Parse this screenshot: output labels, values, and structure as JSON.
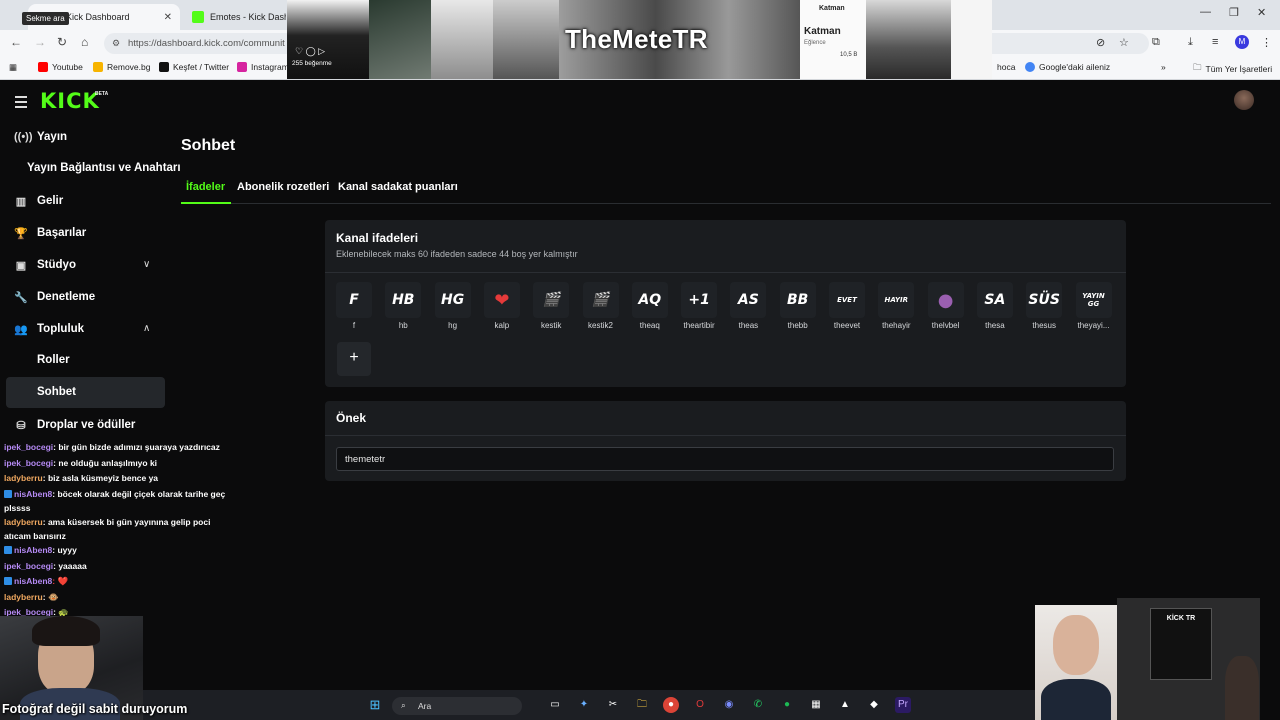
{
  "browser": {
    "tabs": [
      {
        "title": "Kick Dashboard",
        "active": true
      },
      {
        "title": "Emotes - Kick Dashboa",
        "active": false
      }
    ],
    "tooltip": "Sekme ara",
    "url": "https://dashboard.kick.com/communit",
    "profile_initial": "M",
    "bookmarks": [
      {
        "label": "Youtube",
        "color": "#ff0000"
      },
      {
        "label": "Remove.bg",
        "color": "#f7b400"
      },
      {
        "label": "Keşfet / Twitter",
        "color": "#111111"
      },
      {
        "label": "Instagram",
        "color": "#d6249f"
      },
      {
        "label": "hoca",
        "color": ""
      },
      {
        "label": "Google'daki aileniz",
        "color": "#4285f4"
      },
      {
        "label": "Tüm Yer İşaretleri",
        "color": ""
      }
    ]
  },
  "overlay": {
    "title": "TheMeteTR",
    "likes": "255 beğenme",
    "card_title": "Katman",
    "card_sub": "Eğlence",
    "card_count": "10,5 B"
  },
  "app": {
    "logo": "KICK",
    "beta": "BETA",
    "sidebar": [
      {
        "label": "Yayın",
        "icon": "broadcast-icon"
      },
      {
        "label": "Yayın Bağlantısı ve Anahtarı",
        "icon": ""
      },
      {
        "label": "Gelir",
        "icon": "chart-icon"
      },
      {
        "label": "Başarılar",
        "icon": "trophy-icon"
      },
      {
        "label": "Stüdyo",
        "icon": "studio-icon"
      },
      {
        "label": "Denetleme",
        "icon": "wrench-icon"
      },
      {
        "label": "Topluluk",
        "icon": "community-icon"
      },
      {
        "label": "Roller",
        "icon": ""
      },
      {
        "label": "Sohbet",
        "icon": ""
      },
      {
        "label": "Droplar ve ödüller",
        "icon": "drops-icon"
      }
    ],
    "page_title": "Sohbet",
    "tabs": [
      "İfadeler",
      "Abonelik rozetleri",
      "Kanal sadakat puanları"
    ],
    "emotes_card": {
      "title": "Kanal ifadeleri",
      "subtitle": "Eklenebilecek maks 60 ifadeden sadece 44 boş yer kalmıştır",
      "emotes": [
        {
          "glyph": "F",
          "label": "f"
        },
        {
          "glyph": "HB",
          "label": "hb"
        },
        {
          "glyph": "HG",
          "label": "hg"
        },
        {
          "glyph": "❤",
          "label": "kalp"
        },
        {
          "glyph": "🎬",
          "label": "kestik"
        },
        {
          "glyph": "🎬",
          "label": "kestik2"
        },
        {
          "glyph": "AQ",
          "label": "theaq"
        },
        {
          "glyph": "+1",
          "label": "theartibir"
        },
        {
          "glyph": "AS",
          "label": "theas"
        },
        {
          "glyph": "BB",
          "label": "thebb"
        },
        {
          "glyph": "EVET",
          "label": "theevet"
        },
        {
          "glyph": "HAYIR",
          "label": "thehayir"
        },
        {
          "glyph": "●",
          "label": "thelvbel"
        },
        {
          "glyph": "SA",
          "label": "thesa"
        },
        {
          "glyph": "SÜS",
          "label": "thesus"
        },
        {
          "glyph": "YAYIN GG",
          "label": "theyayi..."
        }
      ],
      "add_label": "+"
    },
    "prefix_card": {
      "title": "Önek",
      "value": "themetetr"
    }
  },
  "chat": [
    {
      "user": "ipek_bocegi",
      "msg": ": bir gün bizde adımızı şuaraya yazdırıcaz",
      "badge": false
    },
    {
      "user": "ipek_bocegi",
      "msg": ": ne olduğu anlaşılmıyo ki",
      "badge": false
    },
    {
      "user": "ladyberru",
      "msg": ": biz asla küsmeyiz bence ya",
      "badge": false
    },
    {
      "user": "nisAben8",
      "msg": ": böcek olarak değil çiçek olarak tarihe geç plssss",
      "badge": true
    },
    {
      "user": "ladyberru",
      "msg": ": ama küsersek bi gün yayınına gelip poci atıcam barısırız",
      "badge": false
    },
    {
      "user": "nisAben8",
      "msg": ": uyyy",
      "badge": true
    },
    {
      "user": "ipek_bocegi",
      "msg": ": yaaaaa",
      "badge": false
    },
    {
      "user": "nisAben8",
      "msg": ": ❤️",
      "badge": true
    },
    {
      "user": "ladyberru",
      "msg": ": 🐵",
      "badge": false
    },
    {
      "user": "ipek_bocegi",
      "msg": ": 🐢",
      "badge": false
    }
  ],
  "stream": {
    "caption": "Fotoğraf değil sabit duruyorum",
    "kick_tr": "KİCK TR"
  },
  "taskbar": {
    "search_label": "Ara"
  }
}
